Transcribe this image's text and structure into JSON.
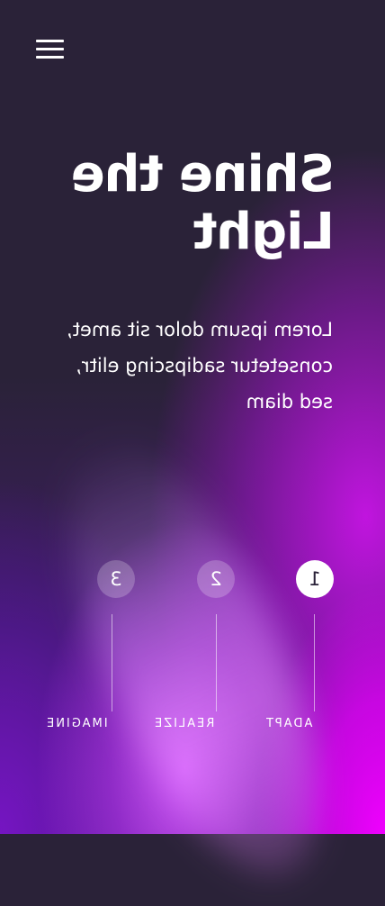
{
  "header": {
    "menu_icon": "hamburger-menu-icon"
  },
  "hero": {
    "title": "Shine the Light",
    "subtitle": "Lorem ipsum dolor sit amet, consetetur sadipscing elitr, sed diam"
  },
  "steps": [
    {
      "number": "1",
      "label": "ADAPT",
      "active": true
    },
    {
      "number": "2",
      "label": "REALIZE",
      "active": false
    },
    {
      "number": "3",
      "label": "IMAGINE",
      "active": false
    }
  ],
  "colors": {
    "background_dark": "#2a2238",
    "accent_magenta": "#f000ff",
    "accent_purple": "#7a1fc0",
    "active_step_bg": "#ffffff"
  }
}
